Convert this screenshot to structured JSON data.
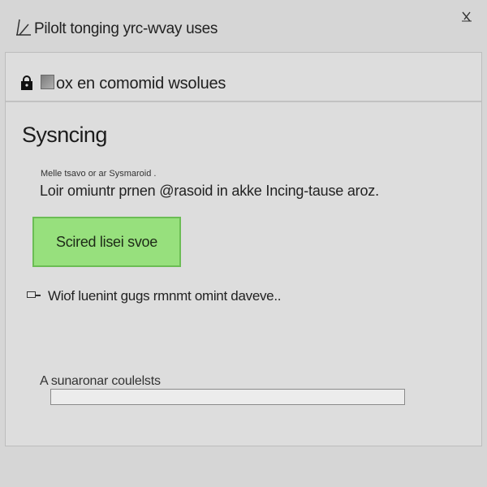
{
  "window": {
    "title": "Pilolt tonging yrc-wvay uses",
    "close_label": "close"
  },
  "panel": {
    "header_title": "ox en comomid wsolues"
  },
  "main": {
    "section_heading": "Sysncing",
    "note": "Melle tsavo or ar Sysmaroid .",
    "description": "Loir omiuntr prnen @rasoid in akke Incing-tause aroz.",
    "sync_button_label": "Scired lisei svoe",
    "option_label": "Wiof luenint gugs rmnmt omint daveve..",
    "option_checked": false,
    "field_label": "A sunaronar coulelsts",
    "field_value": "",
    "field_placeholder": ""
  },
  "colors": {
    "accent_green": "#97e07d",
    "accent_green_border": "#6bbd54",
    "background": "#d6d6d6"
  },
  "icons": {
    "app": "pencil-edit-icon",
    "close": "close-icon",
    "lock": "lock-icon",
    "box": "box-icon"
  }
}
